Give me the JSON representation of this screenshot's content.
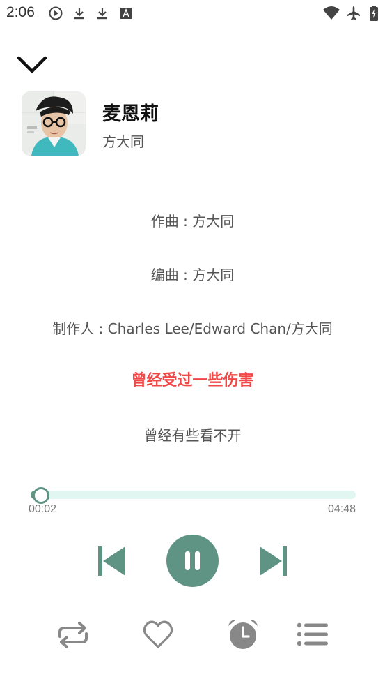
{
  "status_bar": {
    "time": "2:06",
    "icons": [
      "play-circle-icon",
      "download-icon",
      "download-icon",
      "a-notification-icon",
      "wifi-icon",
      "airplane-icon",
      "battery-charging-icon"
    ]
  },
  "song": {
    "title": "麦恩莉",
    "artist": "方大同"
  },
  "lyrics": {
    "lines": [
      "作曲 : 方大同",
      "编曲 : 方大同",
      "制作人 : Charles Lee/Edward Chan/方大同",
      "曾经受过一些伤害",
      "曾经有些看不开"
    ],
    "active_index": 3
  },
  "player": {
    "current_time": "00:02",
    "total_time": "04:48",
    "progress_fraction": 0.007,
    "state": "playing"
  },
  "colors": {
    "accent": "#5f9485",
    "track": "#e2f6f1",
    "active_lyric": "#f04848",
    "icon_gray": "#888888"
  },
  "bottom_actions": [
    "repeat-icon",
    "heart-icon",
    "alarm-clock-icon",
    "playlist-icon"
  ]
}
